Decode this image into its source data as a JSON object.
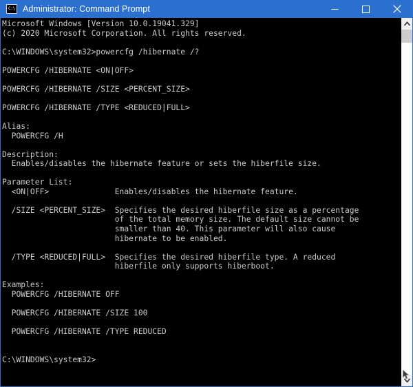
{
  "window": {
    "title": "Administrator: Command Prompt",
    "icon_label": "C:\\",
    "icon_name": "console-icon",
    "titlebar_color": "#2b70cf",
    "background_color": "#000000",
    "text_color": "#cccccc",
    "controls": {
      "minimize": "Minimize",
      "maximize": "Maximize",
      "close": "Close"
    }
  },
  "console": {
    "lines": [
      "Microsoft Windows [Version 10.0.19041.329]",
      "(c) 2020 Microsoft Corporation. All rights reserved.",
      "",
      "C:\\WINDOWS\\system32>powercfg /hibernate /?",
      "",
      "POWERCFG /HIBERNATE <ON|OFF>",
      "",
      "POWERCFG /HIBERNATE /SIZE <PERCENT_SIZE>",
      "",
      "POWERCFG /HIBERNATE /TYPE <REDUCED|FULL>",
      "",
      "Alias:",
      "  POWERCFG /H",
      "",
      "Description:",
      "  Enables/disables the hibernate feature or sets the hiberfile size.",
      "",
      "Parameter List:",
      "  <ON|OFF>              Enables/disables the hibernate feature.",
      "",
      "  /SIZE <PERCENT_SIZE>  Specifies the desired hiberfile size as a percentage",
      "                        of the total memory size. The default size cannot be",
      "                        smaller than 40. This parameter will also cause",
      "                        hibernate to be enabled.",
      "",
      "  /TYPE <REDUCED|FULL>  Specifies the desired hiberfile type. A reduced",
      "                        hiberfile only supports hiberboot.",
      "",
      "Examples:",
      "  POWERCFG /HIBERNATE OFF",
      "",
      "  POWERCFG /HIBERNATE /SIZE 100",
      "",
      "  POWERCFG /HIBERNATE /TYPE REDUCED",
      "",
      "",
      "C:\\WINDOWS\\system32>"
    ],
    "command": "powercfg /hibernate /?",
    "prompt": "C:\\WINDOWS\\system32>",
    "version_line": "Microsoft Windows [Version 10.0.19041.329]",
    "copyright_line": "(c) 2020 Microsoft Corporation. All rights reserved."
  },
  "scrollbar": {
    "up_arrow": "scroll-up",
    "down_arrow": "scroll-down",
    "thumb": "scroll-thumb"
  }
}
